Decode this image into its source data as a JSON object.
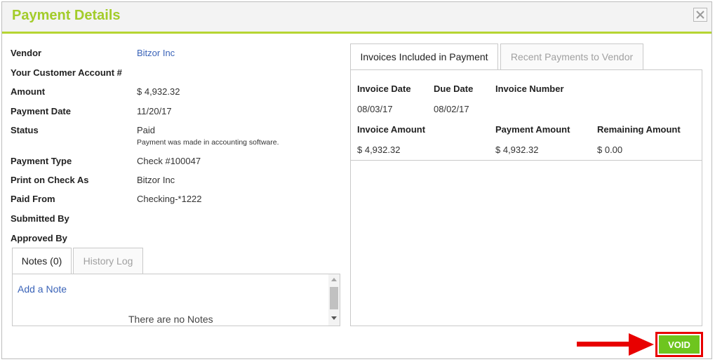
{
  "dialog": {
    "title": "Payment Details"
  },
  "details": {
    "vendor": {
      "label": "Vendor",
      "value": "Bitzor Inc"
    },
    "account": {
      "label": "Your Customer Account #"
    },
    "amount": {
      "label": "Amount",
      "value": "$ 4,932.32"
    },
    "payment_date": {
      "label": "Payment Date",
      "value": "11/20/17"
    },
    "status": {
      "label": "Status",
      "value": "Paid",
      "note": "Payment was made in accounting software."
    },
    "payment_type": {
      "label": "Payment Type",
      "value": "Check #100047"
    },
    "print_as": {
      "label": "Print on Check As",
      "value": "Bitzor Inc"
    },
    "paid_from": {
      "label": "Paid From",
      "value": "Checking-*1222"
    },
    "submitted_by": {
      "label": "Submitted By"
    },
    "approved_by": {
      "label": "Approved By"
    }
  },
  "notes_tabs": [
    {
      "label": "Notes (0)"
    },
    {
      "label": "History Log"
    }
  ],
  "notes": {
    "add_label": "Add a Note",
    "empty_text": "There are no Notes"
  },
  "invoice_tabs": [
    {
      "label": "Invoices Included in Payment"
    },
    {
      "label": "Recent Payments to Vendor"
    }
  ],
  "invoice": {
    "headers": {
      "invoice_date": "Invoice Date",
      "due_date": "Due Date",
      "invoice_number": "Invoice Number",
      "invoice_amount": "Invoice Amount",
      "payment_amount": "Payment Amount",
      "remaining_amount": "Remaining Amount"
    },
    "row": {
      "invoice_date": "08/03/17",
      "due_date": "08/02/17",
      "invoice_number": "",
      "invoice_amount": "$ 4,932.32",
      "payment_amount": "$ 4,932.32",
      "remaining_amount": "$ 0.00"
    }
  },
  "actions": {
    "void_label": "VOID"
  },
  "colors": {
    "accent": "#a3cc2a",
    "link": "#3a63b8",
    "void_button": "#6ec51e",
    "highlight": "#e80000"
  },
  "icons": {
    "close": "close-icon",
    "highlight_arrow": "arrow-right-icon"
  }
}
